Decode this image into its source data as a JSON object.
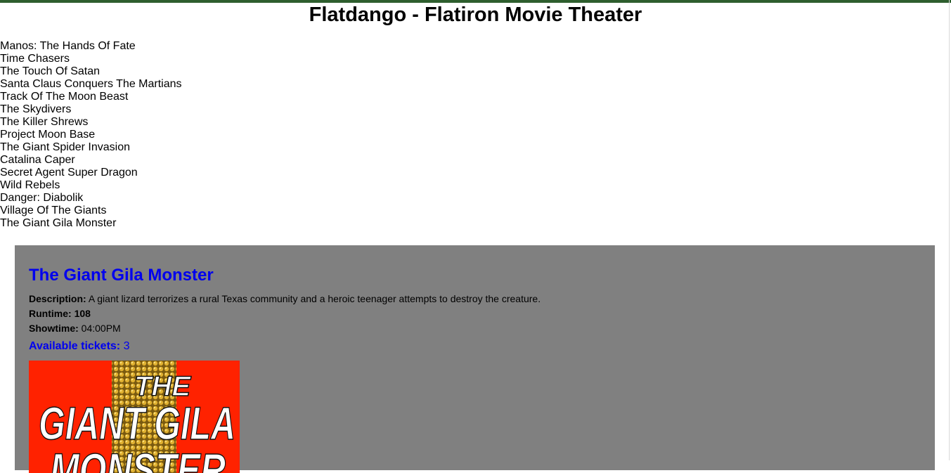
{
  "header": {
    "title": "Flatdango - Flatiron Movie Theater"
  },
  "films": [
    "Manos: The Hands Of Fate",
    "Time Chasers",
    "The Touch Of Satan",
    "Santa Claus Conquers The Martians",
    "Track Of The Moon Beast",
    "The Skydivers",
    "The Killer Shrews",
    "Project Moon Base",
    "The Giant Spider Invasion",
    "Catalina Caper",
    "Secret Agent Super Dragon",
    "Wild Rebels",
    "Danger: Diabolik",
    "Village Of The Giants",
    "The Giant Gila Monster"
  ],
  "details": {
    "title": "The Giant Gila Monster",
    "description_label": "Description:",
    "description": "A giant lizard terrorizes a rural Texas community and a heroic teenager attempts to destroy the creature.",
    "runtime_label": "Runtime:",
    "runtime": "108",
    "showtime_label": "Showtime:",
    "showtime": "04:00PM",
    "tickets_label": "Available tickets:",
    "tickets": "3",
    "poster": {
      "line1": "THE",
      "line2": "GIANT GILA",
      "line3": "MONSTER"
    }
  },
  "colors": {
    "top_bar": "#2e5e2e",
    "card_background": "#808080",
    "link_blue": "#0000ee",
    "poster_red": "#ff2200"
  }
}
